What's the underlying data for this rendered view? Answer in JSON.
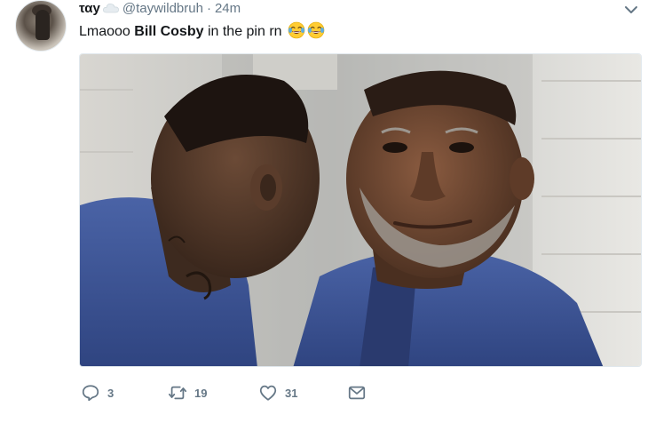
{
  "tweet": {
    "display_name": "ταy",
    "name_icon": "cloud-icon",
    "handle": "@taywildbruh",
    "separator": "·",
    "timestamp": "24m",
    "text_before": "Lmaooo ",
    "text_bold": "Bill Cosby",
    "text_after": " in the pin rn",
    "emoji": [
      "face-with-tears-of-joy",
      "face-with-tears-of-joy"
    ],
    "media_description_icon": "photo",
    "actions": {
      "reply": {
        "icon": "reply-icon",
        "count": "3"
      },
      "retweet": {
        "icon": "retweet-icon",
        "count": "19"
      },
      "like": {
        "icon": "heart-icon",
        "count": "31"
      },
      "dm": {
        "icon": "envelope-icon"
      }
    },
    "caret_icon": "chevron-down-icon"
  },
  "colors": {
    "text": "#14171a",
    "secondary": "#657786",
    "border": "#e1e8ed"
  }
}
